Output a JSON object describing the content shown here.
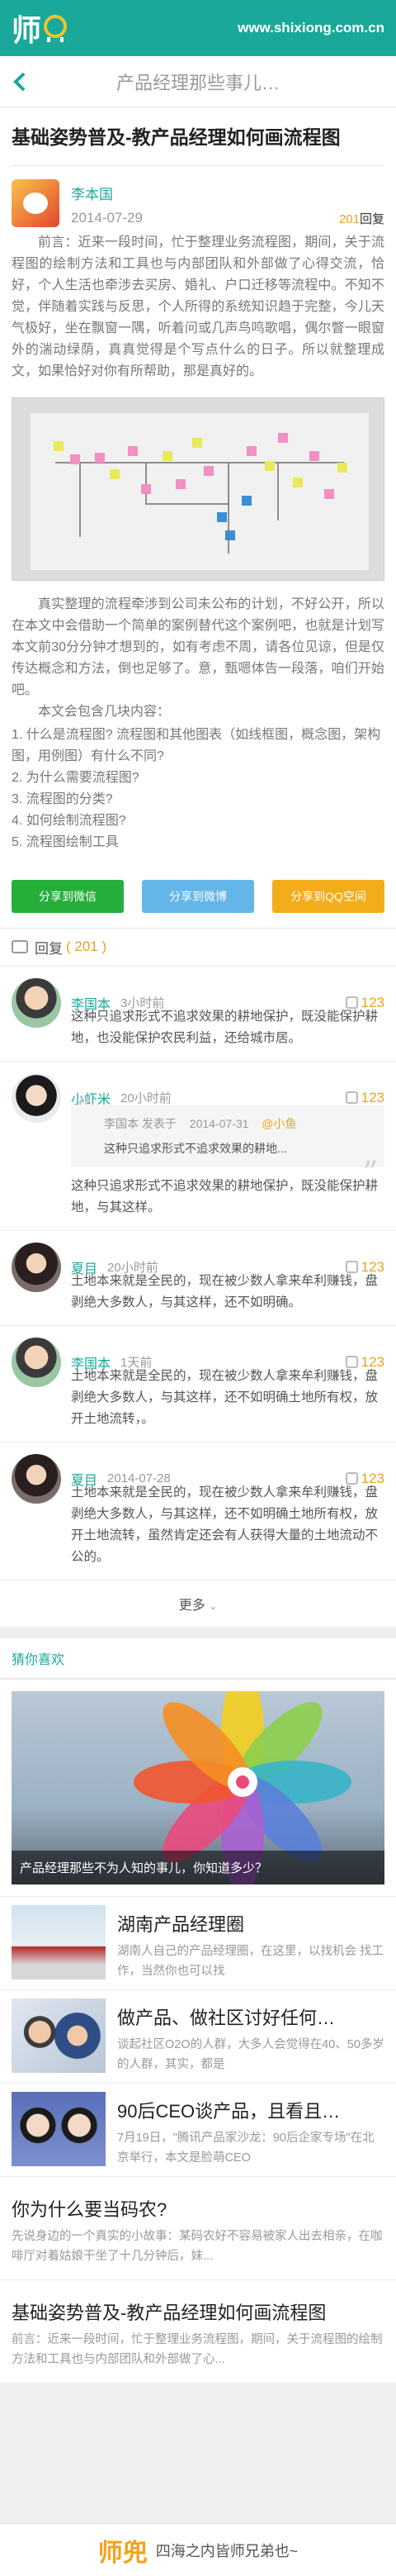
{
  "header": {
    "logo_text": "师",
    "logo_glyph": "兜",
    "site_url": "www.shixiong.com.cn"
  },
  "navbar": {
    "title": "产品经理那些事儿…"
  },
  "article": {
    "title": "基础姿势普及-教产品经理如何画流程图",
    "author": "李本国",
    "date": "2014-07-29",
    "reply_count": "201",
    "reply_suffix": "回复",
    "para1": "前言：近来一段时间，忙于整理业务流程图，期间，关于流程图的绘制方法和工具也与内部团队和外部做了心得交流，恰好，个人生活也牵涉去买房、婚礼、户口迁移等流程中。不知不觉，伴随着实践与反思，个人所得的系统知识趋于完整，今儿天气极好，坐在飘窗一隅，听着问或几声鸟鸣歌唱，偶尔瞥一眼窗外的湍动绿荫，真真觉得是个写点什么的日子。所以就整理成文，如果恰好对你有所帮助，那是真好的。",
    "para2": "真实整理的流程牵涉到公司未公布的计划，不好公开，所以在本文中会借助一个简单的案例替代这个案例吧，也就是计划写本文前30分分钟才想到的，如有考虑不周，请各位见谅，但是仅传达概念和方法，倒也足够了。意，甄嗯体告一段落，咱们开始吧。",
    "toc_intro": "本文会包含几块内容：",
    "toc": [
      "1. 什么是流程图? 流程图和其他图表（如线框图，概念图，架构图，用例图）有什么不同?",
      "2. 为什么需要流程图?",
      "3. 流程图的分类?",
      "4. 如何绘制流程图?",
      "5. 流程图绘制工具"
    ]
  },
  "share": {
    "wechat": "分享到微信",
    "weibo": "分享到微博",
    "qq": "分享到QQ空间"
  },
  "replies": {
    "label": "回复",
    "count": "( 201 )",
    "more": "更多",
    "items": [
      {
        "name": "李国本",
        "time": "3小时前",
        "likes": "123",
        "text": "这种只追求形式不追求效果的耕地保护，既没能保护耕地，也没能保护农民利益，还给城市居。"
      },
      {
        "name": "小虾米",
        "time": "20小时前",
        "likes": "123",
        "quote_author": "李国本 发表于",
        "quote_date": "2014-07-31",
        "quote_at": "@小鱼",
        "quote_text": "这种只追求形式不追求效果的耕地...",
        "text": "这种只追求形式不追求效果的耕地保护，既没能保护耕地，与其这样。"
      },
      {
        "name": "夏目",
        "time": "20小时前",
        "likes": "123",
        "text": "土地本来就是全民的，现在被少数人拿来牟利赚钱，盘剥绝大多数人，与其这样，还不如明确。"
      },
      {
        "name": "李国本",
        "time": "1天前",
        "likes": "123",
        "text": "土地本来就是全民的，现在被少数人拿来牟利赚钱，盘剥绝大多数人，与其这样，还不如明确土地所有权，放开土地流转，。"
      },
      {
        "name": "夏目",
        "time": "2014-07-28",
        "likes": "123",
        "text": "土地本来就是全民的，现在被少数人拿来牟利赚钱，盘剥绝大多数人，与其这样，还不如明确土地所有权，放开土地流转，虽然肯定还会有人获得大量的土地流动不公的。"
      }
    ]
  },
  "guess": {
    "title": "猜你喜欢",
    "feature_caption": "产品经理那些不为人知的事儿，你知道多少？",
    "items": [
      {
        "title": "湖南产品经理圈",
        "desc": "湖南人自己的产品经理圈，在这里，以找机会 找工作，当然你也可以找"
      },
      {
        "title": "做产品、做社区讨好任何…",
        "desc": "谈起社区O2O的人群，大多人会觉得在40、50多岁的人群，其实，都是"
      },
      {
        "title": "90后CEO谈产品，且看且…",
        "desc": "7月19日，\"腾讯产品家沙龙：90后企家专场\"在北京举行，本文是脸萌CEO"
      }
    ],
    "text_items": [
      {
        "title": "你为什么要当码农?",
        "desc": "先说身边的一个真实的小故事：某码农好不容易被家人出去相亲，在咖啡厅对着姑娘干坐了十几分钟后，妹..."
      },
      {
        "title": "基础姿势普及-教产品经理如何画流程图",
        "desc": "前言：近来一段时间，忙于整理业务流程图，期间，关于流程图的绘制方法和工具也与内部团队和外部做了心..."
      }
    ]
  },
  "footer": {
    "logo": "师兜",
    "slogan": "四海之内皆师兄弟也~"
  },
  "colors": {
    "brand": "#1aa89a",
    "accent": "#e8a31f",
    "wechat": "#25ae3a",
    "weibo": "#64b6e9",
    "qq": "#f3ad1a"
  },
  "icons": [
    "back-arrow-icon",
    "reply-bubble-icon",
    "thumbs-up-icon",
    "chevron-down-icon",
    "quote-mark-icon"
  ]
}
